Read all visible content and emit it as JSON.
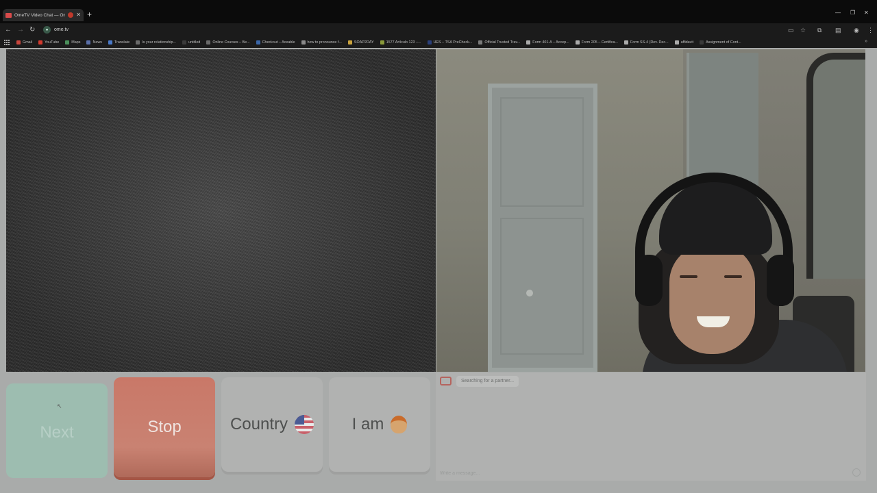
{
  "browser": {
    "tab_title": "OmeTV Video Chat — Ome",
    "url": "ome.tv",
    "bookmarks": [
      {
        "label": "Gmail",
        "color": "#c9463d"
      },
      {
        "label": "YouTube",
        "color": "#d23a2e"
      },
      {
        "label": "Maps",
        "color": "#4a8f5a"
      },
      {
        "label": "News",
        "color": "#5a6fa8"
      },
      {
        "label": "Translate",
        "color": "#4a79c8"
      },
      {
        "label": "Is your relationship...",
        "color": "#6a6a6a"
      },
      {
        "label": "untitled",
        "color": "#3a3a3a"
      },
      {
        "label": "Online Courses – Be...",
        "color": "#6a6a6a"
      },
      {
        "label": "Checkout – Aceable",
        "color": "#3a66a8"
      },
      {
        "label": "how to pronounce f...",
        "color": "#8a8a8a"
      },
      {
        "label": "SOAP2DAY",
        "color": "#c9a23d"
      },
      {
        "label": "1577 Artículo 123 –...",
        "color": "#8a9a3a"
      },
      {
        "label": "UES – TSA PreCheck...",
        "color": "#2a3f7a"
      },
      {
        "label": "Official Trusted Trav...",
        "color": "#7a7a7a"
      },
      {
        "label": "Form 401-A – Accep...",
        "color": "#aaaaaa"
      },
      {
        "label": "Form 205 – Certifica...",
        "color": "#aaaaaa"
      },
      {
        "label": "Form SS-4 (Rev. Dec...",
        "color": "#aaaaaa"
      },
      {
        "label": "affidavit",
        "color": "#aaaaaa"
      },
      {
        "label": "Assignment of Cont...",
        "color": "#3a3a3a"
      }
    ]
  },
  "controls": {
    "next_label": "Next",
    "stop_label": "Stop",
    "country_label": "Country",
    "iam_label": "I am"
  },
  "chat": {
    "status": "Searching for a partner...",
    "input_placeholder": "Write a message..."
  },
  "colors": {
    "next": "#9dbdb0",
    "stop": "#c97868",
    "neutral_button": "#b1b2b1",
    "page_bg": "#a9abaa"
  }
}
